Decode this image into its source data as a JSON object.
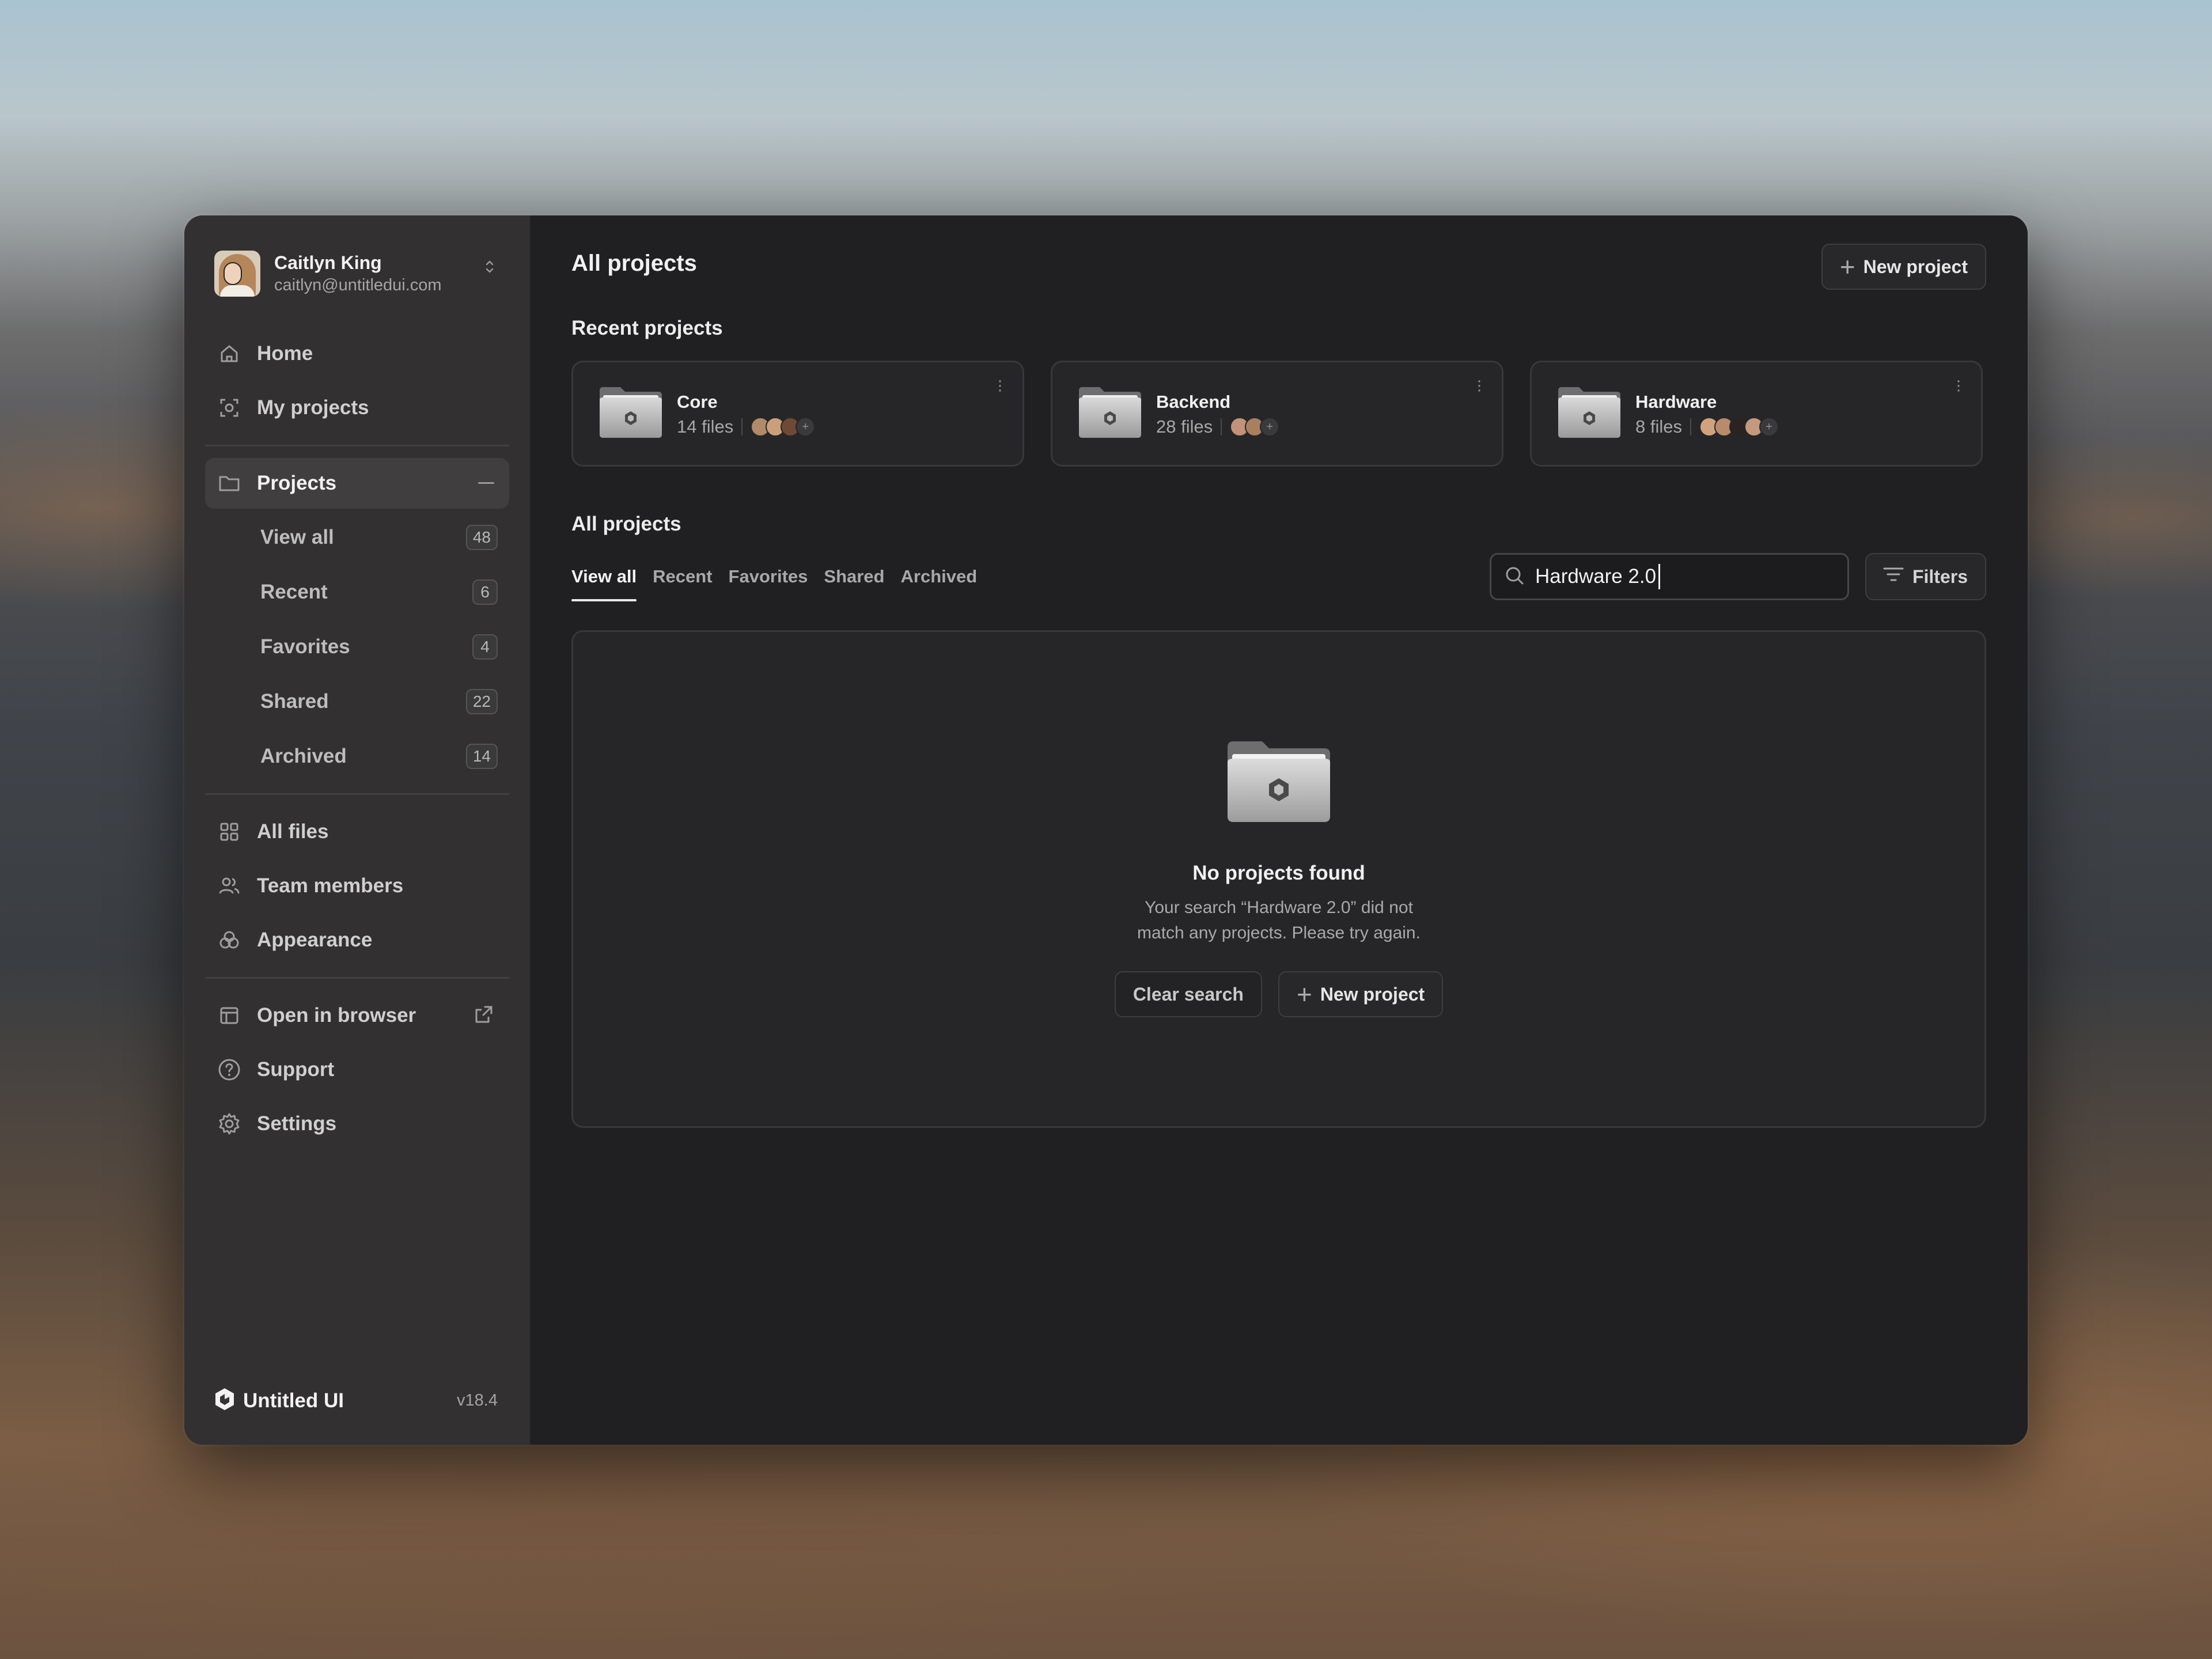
{
  "user": {
    "name": "Caitlyn King",
    "email": "caitlyn@untitledui.com"
  },
  "nav_top": [
    {
      "label": "Home",
      "icon": "home-icon"
    },
    {
      "label": "My projects",
      "icon": "scan-icon"
    }
  ],
  "projects_nav": {
    "label": "Projects",
    "sub": [
      {
        "label": "View all",
        "count": "48"
      },
      {
        "label": "Recent",
        "count": "6"
      },
      {
        "label": "Favorites",
        "count": "4"
      },
      {
        "label": "Shared",
        "count": "22"
      },
      {
        "label": "Archived",
        "count": "14"
      }
    ]
  },
  "nav_mid": [
    {
      "label": "All files",
      "icon": "grid-icon"
    },
    {
      "label": "Team members",
      "icon": "users-icon"
    },
    {
      "label": "Appearance",
      "icon": "palette-icon"
    }
  ],
  "nav_bottom": [
    {
      "label": "Open in browser",
      "icon": "browser-icon"
    },
    {
      "label": "Support",
      "icon": "help-icon"
    },
    {
      "label": "Settings",
      "icon": "gear-icon"
    }
  ],
  "footer": {
    "brand": "Untitled UI",
    "version": "v18.4"
  },
  "header": {
    "title": "All projects",
    "new_project": "New project"
  },
  "recent": {
    "title": "Recent projects",
    "cards": [
      {
        "name": "Core",
        "files": "14 files",
        "faces": [
          "#b08a6a",
          "#c9a07a",
          "#6e4a35"
        ]
      },
      {
        "name": "Backend",
        "files": "28 files",
        "faces": [
          "#c29279",
          "#a8805f"
        ]
      },
      {
        "name": "Hardware",
        "files": "8 files",
        "faces": [
          "#d0a37e",
          "#b98b6b",
          "#2a2320",
          "#c59a7c"
        ]
      }
    ]
  },
  "all": {
    "title": "All projects",
    "tabs": [
      "View all",
      "Recent",
      "Favorites",
      "Shared",
      "Archived"
    ],
    "search_value": "Hardware 2.0",
    "filters": "Filters"
  },
  "empty": {
    "title": "No projects found",
    "desc_line1": "Your search “Hardware 2.0” did not",
    "desc_line2": "match any projects. Please try again.",
    "clear": "Clear search",
    "new_project": "New project"
  },
  "colors": {
    "panel": "#202022",
    "sidebar": "#343232",
    "border": "#38383b",
    "text": "#f0f0f0"
  }
}
